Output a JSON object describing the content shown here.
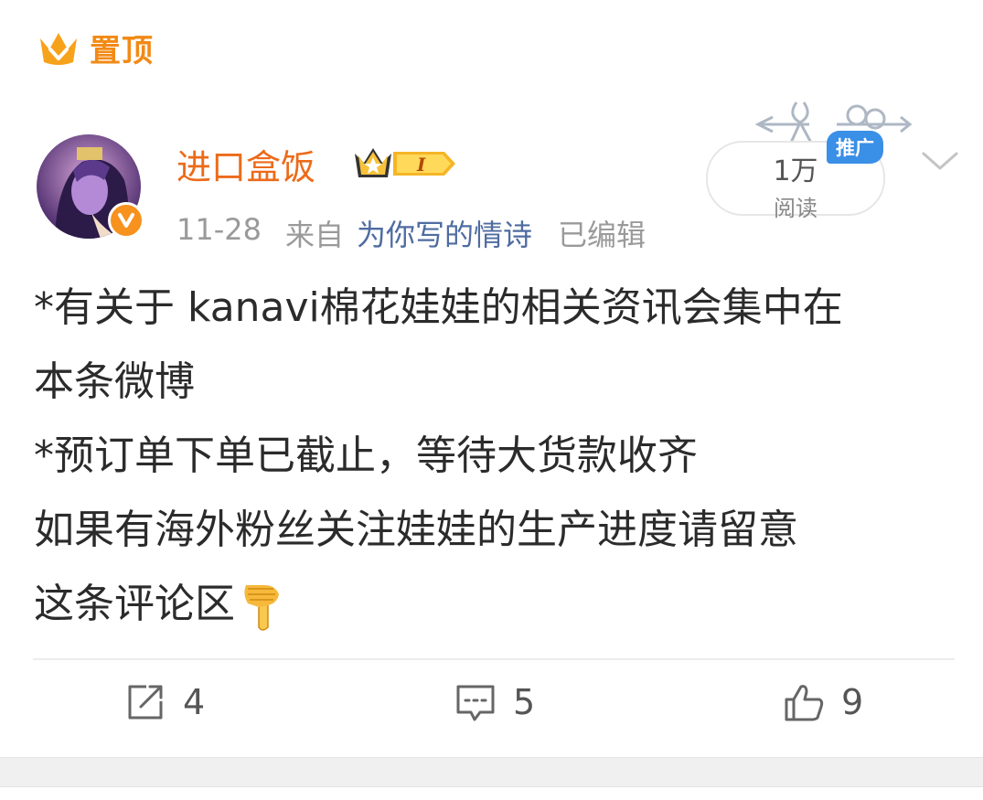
{
  "pinned": {
    "label": "置顶"
  },
  "author": {
    "name": "进口盒饭",
    "level": "I"
  },
  "meta": {
    "date": "11-28",
    "from_label": "来自",
    "source": "为你写的情诗",
    "edited": "已编辑"
  },
  "reads": {
    "count": "1万",
    "label": "阅读",
    "promo": "推广"
  },
  "post": {
    "lines": [
      "*有关于 kanavi棉花娃娃的相关资讯会集中在",
      "本条微博",
      "*预订单下单已截止，等待大货款收齐",
      "如果有海外粉丝关注娃娃的生产进度请留意",
      "这条评论区"
    ]
  },
  "actions": {
    "repost": "4",
    "comment": "5",
    "like": "9"
  },
  "colors": {
    "accent": "#f28a16",
    "name": "#ec6b1a",
    "link": "#4f6ca1",
    "promo": "#3a8fe6"
  }
}
